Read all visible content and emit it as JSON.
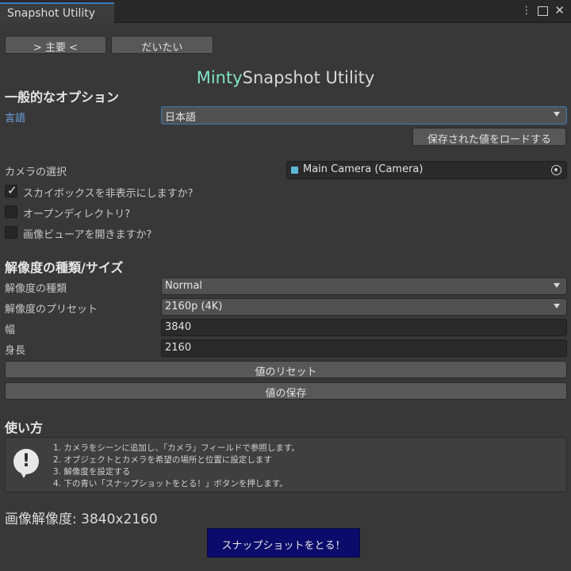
{
  "window": {
    "tab_title": "Snapshot Utility",
    "icons": [
      "more-vert-icon",
      "maximize-icon",
      "close-icon"
    ]
  },
  "top_buttons": {
    "main": "> 主要 <",
    "approx": "だいたい"
  },
  "title": {
    "prefix": "Minty",
    "rest": "Snapshot Utility",
    "prefix_color": "#7fe3c8"
  },
  "general": {
    "header": "一般的なオプション",
    "language_label": "言語",
    "language_value": "日本語",
    "load_button": "保存された値をロードする"
  },
  "camera": {
    "label": "カメラの選択",
    "value": "Main Camera (Camera)"
  },
  "options": [
    {
      "label": "スカイボックスを非表示にしますか?",
      "checked": true
    },
    {
      "label": "オープンディレクトリ?",
      "checked": false
    },
    {
      "label": "画像ビューアを開きますか?",
      "checked": false
    }
  ],
  "resolution": {
    "header": "解像度の種類/サイズ",
    "type_label": "解像度の種類",
    "type_value": "Normal",
    "preset_label": "解像度のプリセット",
    "preset_value": "2160p (4K)",
    "width_label": "幅",
    "width_value": "3840",
    "height_label": "身長",
    "height_value": "2160",
    "reset_button": "値のリセット",
    "save_button": "値の保存"
  },
  "usage": {
    "header": "使い方",
    "steps": [
      "1. カメラをシーンに追加し、「カメラ」フィールドで参照します。",
      "2. オブジェクトとカメラを希望の場所と位置に設定します",
      "3. 解像度を設定する",
      "4. 下の青い「スナップショットをとる！」ボタンを押します。"
    ]
  },
  "result": {
    "label": "画像解像度: 3840x2160"
  },
  "snapshot_button": "スナップショットをとる！",
  "colors": {
    "accent_blue": "#3a79bb",
    "snapshot_bg": "#0b0b6b",
    "label_blue": "#6aa2e0"
  }
}
